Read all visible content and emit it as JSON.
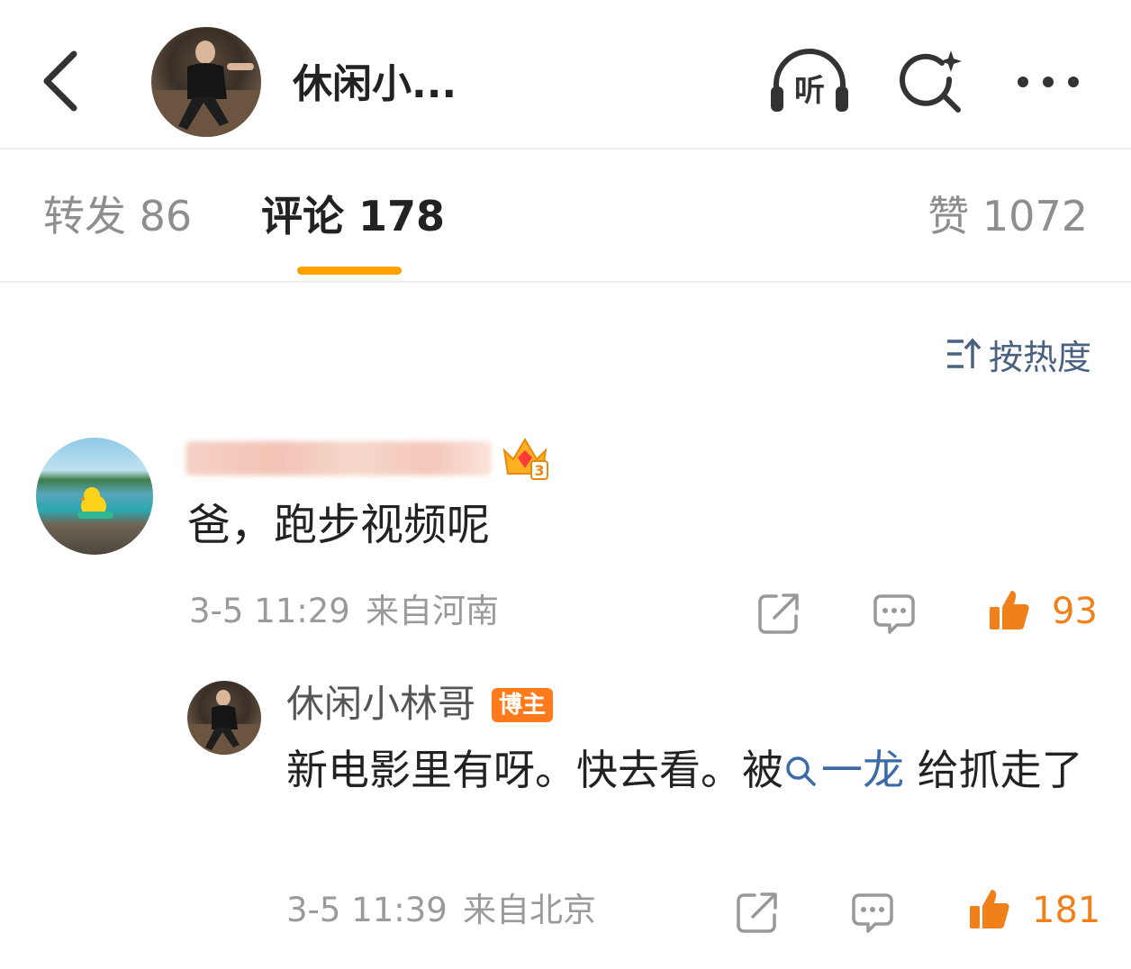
{
  "header": {
    "title": "休闲小...",
    "icons": [
      "back-icon",
      "listen-icon",
      "search-icon",
      "more-icon"
    ],
    "listen_label": "听"
  },
  "tabs": {
    "repost": "转发 86",
    "comments": "评论 178",
    "likes": "赞 1072",
    "active": "comments",
    "accent_color": "#ffa000"
  },
  "sort": {
    "label": "按热度"
  },
  "comment": {
    "badge_level": "3",
    "text": "爸，跑步视频呢",
    "time": "3-5 11:29",
    "location": "来自河南",
    "likes": "93",
    "like_color": "#f0801a"
  },
  "reply": {
    "author": "休闲小林哥",
    "author_badge": "博主",
    "text_before": "新电影里有呀。快去看。被",
    "mention": "一龙",
    "text_after": " 给抓走了",
    "time": "3-5 11:39",
    "location": "来自北京",
    "likes": "181"
  }
}
